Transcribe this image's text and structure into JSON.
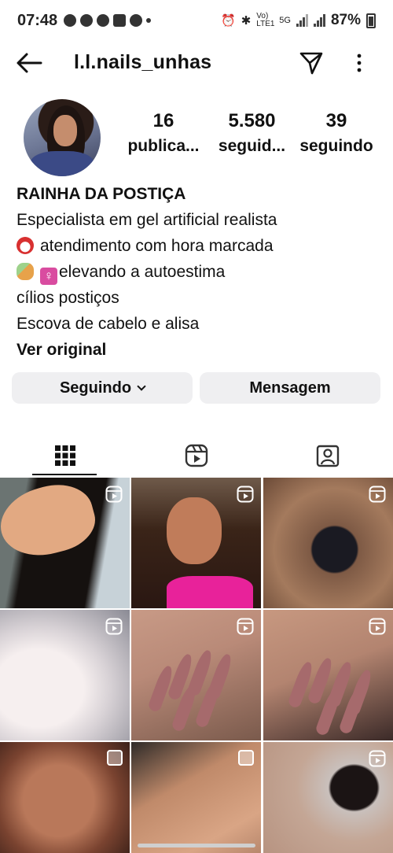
{
  "status_bar": {
    "time": "07:48",
    "network_1": "Vo) LTE1",
    "network_2": "5G",
    "battery_percent": "87%"
  },
  "header": {
    "username": "l.l.nails_unhas",
    "back_icon": "back-arrow-icon",
    "dm_icon": "direct-message-icon",
    "more_icon": "more-vertical-icon"
  },
  "profile": {
    "stats": [
      {
        "value": "16",
        "label": "publica..."
      },
      {
        "value": "5.580",
        "label": "seguid..."
      },
      {
        "value": "39",
        "label": "seguindo"
      }
    ],
    "bio": {
      "name": "RAINHA DA POSTIÇA",
      "lines": [
        "Especialista em gel artificial realista",
        "atendimento com hora marcada",
        "elevando a autoestima",
        "cílios postiços",
        "Escova de cabelo e alisa"
      ],
      "see_original": "Ver original"
    }
  },
  "actions": {
    "following_label": "Seguindo",
    "message_label": "Mensagem"
  },
  "tabs": [
    {
      "name": "grid",
      "icon": "grid-icon",
      "active": true
    },
    {
      "name": "reels",
      "icon": "reels-icon",
      "active": false
    },
    {
      "name": "tagged",
      "icon": "tagged-icon",
      "active": false
    }
  ],
  "posts": [
    {
      "type": "reel"
    },
    {
      "type": "reel"
    },
    {
      "type": "reel"
    },
    {
      "type": "reel"
    },
    {
      "type": "reel"
    },
    {
      "type": "reel"
    },
    {
      "type": "carousel"
    },
    {
      "type": "carousel"
    },
    {
      "type": "reel"
    }
  ],
  "colors": {
    "button_bg": "#efeff1",
    "text": "#111111",
    "accent_pink": "#e8229a"
  }
}
